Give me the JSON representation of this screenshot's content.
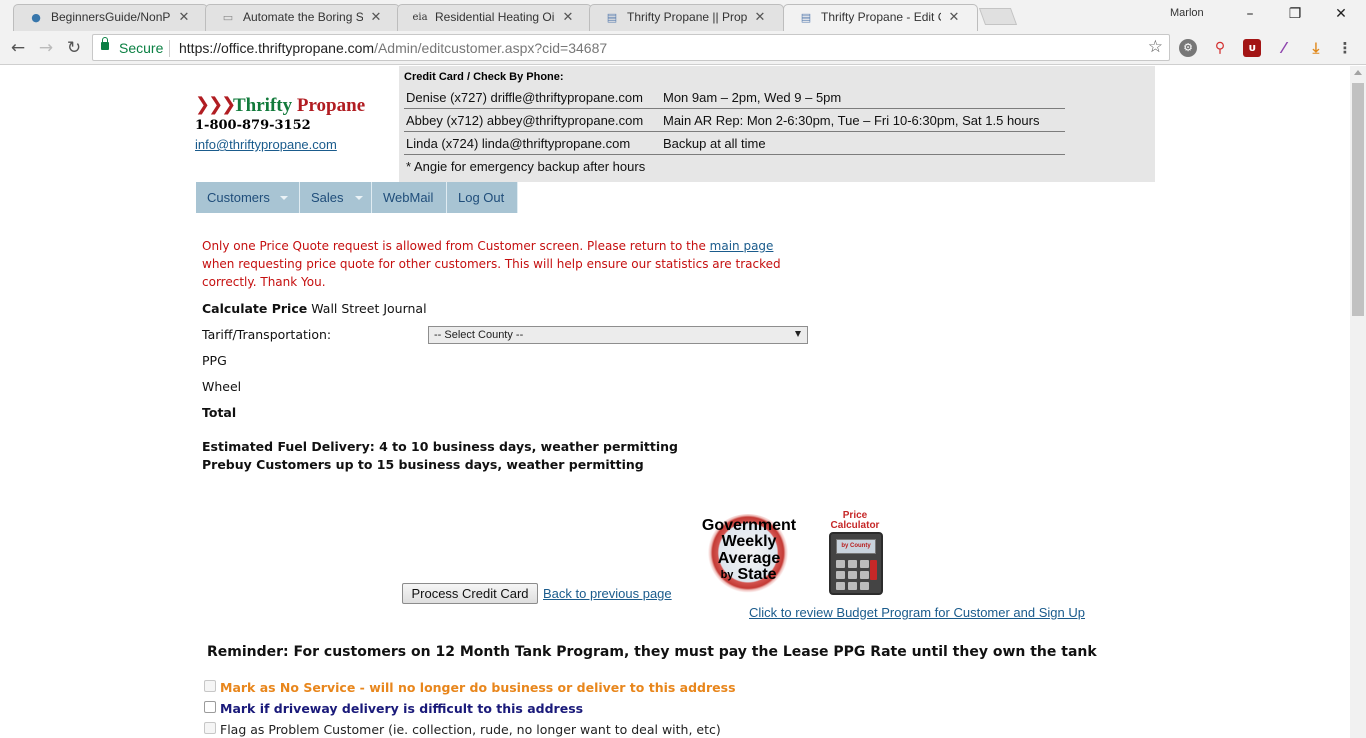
{
  "browser": {
    "tabs": [
      {
        "title": "BeginnersGuide/NonPro",
        "icon": "python-icon"
      },
      {
        "title": "Automate the Boring Stu",
        "icon": "page-icon"
      },
      {
        "title": "Residential Heating Oil V",
        "icon": "eia-icon"
      },
      {
        "title": "Thrifty Propane || Propan",
        "icon": "page-icon"
      },
      {
        "title": "Thrifty Propane - Edit Cu",
        "icon": "page-icon"
      }
    ],
    "profile_name": "Marlon",
    "secure_label": "Secure",
    "url_host": "https://office.thriftypropane.com",
    "url_path": "/Admin/editcustomer.aspx?cid=34687"
  },
  "header": {
    "logo_word1": "Thrifty",
    "logo_word2": "Propane",
    "phone": "1-800-879-3152",
    "email": "info@thriftypropane.com"
  },
  "contact_box": {
    "title": "Credit Card / Check By Phone:",
    "rows": [
      {
        "c1": "Denise (x727) driffle@thriftypropane.com",
        "c2": "Mon 9am – 2pm, Wed 9 – 5pm"
      },
      {
        "c1": "Abbey (x712) abbey@thriftypropane.com",
        "c2": "Main AR Rep: Mon 2-6:30pm, Tue – Fri 10-6:30pm, Sat 1.5 hours"
      },
      {
        "c1": "Linda (x724) linda@thriftypropane.com",
        "c2": "Backup at all time"
      },
      {
        "c1": "* Angie for emergency backup after hours",
        "c2": ""
      }
    ]
  },
  "menu": {
    "customers": "Customers",
    "sales": "Sales",
    "webmail": "WebMail",
    "logout": "Log Out"
  },
  "notice": {
    "text_before": "Only one Price Quote request is allowed from Customer screen. Please return to the ",
    "link": "main page",
    "text_after": " when requesting price quote for other customers. This will help ensure our statistics are tracked correctly. Thank You."
  },
  "calc": {
    "heading": "Calculate Price",
    "source": "Wall Street Journal",
    "tariff_label": "Tariff/Transportation:",
    "county_select": "-- Select County --",
    "ppg_label": "PPG",
    "wheel_label": "Wheel",
    "total_label": "Total"
  },
  "delivery": {
    "line1": "Estimated Fuel Delivery: 4 to 10 business days, weather permitting",
    "line2": "Prebuy Customers up to 15 business days, weather permitting"
  },
  "badges": {
    "gov": [
      "Government",
      "Weekly",
      "Average",
      "by",
      "State"
    ],
    "calc_caption": [
      "Price",
      "Calculator"
    ],
    "calc_screen": "by County"
  },
  "actions": {
    "process_button": "Process Credit Card",
    "back_link": "Back to previous page",
    "budget_link": "Click to review Budget Program for Customer and Sign Up"
  },
  "reminder": "Reminder: For customers on 12 Month Tank Program, they must pay the Lease PPG Rate until they own the tank",
  "checkboxes": [
    {
      "label": "Mark as No Service - will no longer do business or deliver to this address",
      "color": "#e8861c"
    },
    {
      "label": "Mark if driveway delivery is difficult to this address",
      "color": "#1a1a7a"
    },
    {
      "label": "Flag as Problem Customer (ie. collection, rude, no longer want to deal with, etc)",
      "color": "#222222"
    }
  ]
}
